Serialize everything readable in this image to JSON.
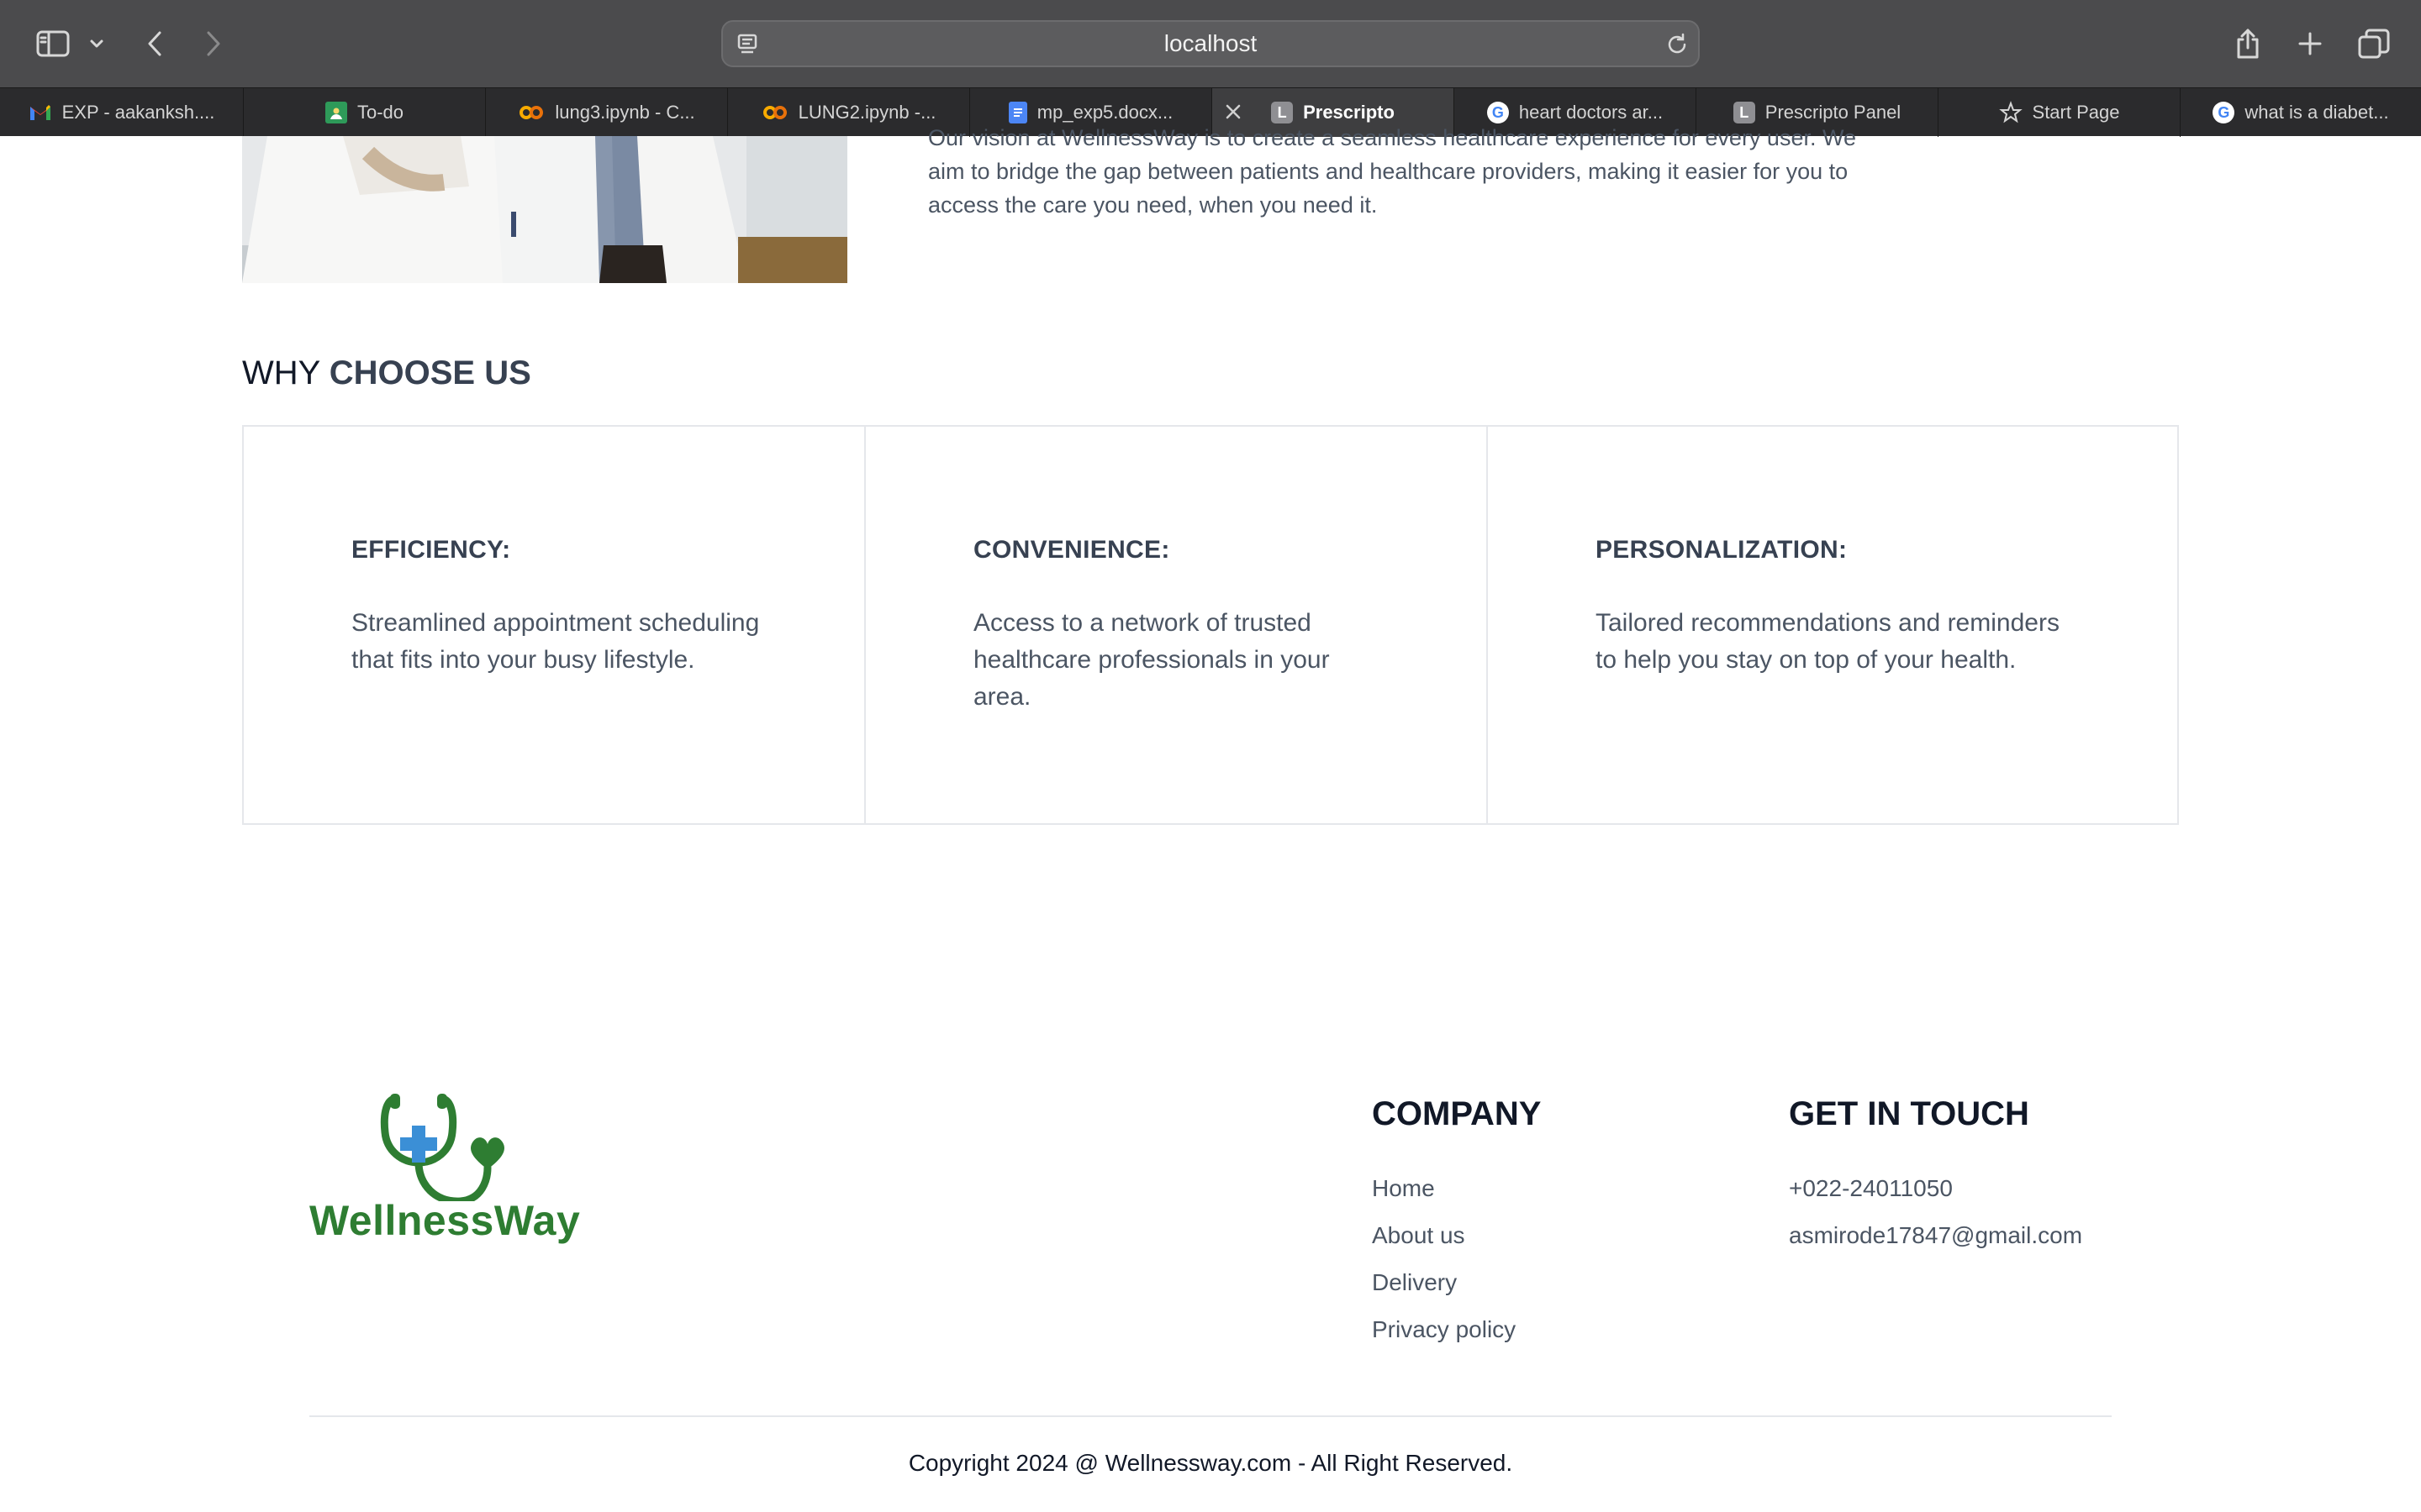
{
  "browser": {
    "url": "localhost",
    "tabs": [
      {
        "label": "EXP - aakanksh....",
        "icon": "gmail-icon"
      },
      {
        "label": "To-do",
        "icon": "todo-icon"
      },
      {
        "label": "lung3.ipynb - C...",
        "icon": "colab-icon"
      },
      {
        "label": "LUNG2.ipynb -...",
        "icon": "colab-icon"
      },
      {
        "label": "mp_exp5.docx...",
        "icon": "docs-icon"
      },
      {
        "label": "Prescripto",
        "icon": "letter-l-icon",
        "favicon_letter": "L",
        "active": true
      },
      {
        "label": "heart doctors ar...",
        "icon": "google-icon",
        "favicon_letter": "G"
      },
      {
        "label": "Prescripto Panel",
        "icon": "letter-l-icon",
        "favicon_letter": "L"
      },
      {
        "label": "Start Page",
        "icon": "star-icon"
      },
      {
        "label": "what is a diabet...",
        "icon": "google-icon",
        "favicon_letter": "G"
      }
    ]
  },
  "about": {
    "vision_text": "Our vision at WellnessWay is to create a seamless healthcare experience for every user. We aim to bridge the gap between patients and healthcare providers, making it easier for you to access the care you need, when you need it."
  },
  "why": {
    "title_prefix": "WHY",
    "title_bold": "CHOOSE US",
    "cards": [
      {
        "title": "EFFICIENCY:",
        "text": "Streamlined appointment scheduling that fits into your busy lifestyle."
      },
      {
        "title": "CONVENIENCE:",
        "text": "Access to a network of trusted healthcare professionals in your area."
      },
      {
        "title": "PERSONALIZATION:",
        "text": "Tailored recommendations and reminders to help you stay on top of your health."
      }
    ]
  },
  "footer": {
    "logo_text": "WellnessWay",
    "company": {
      "title": "COMPANY",
      "links": [
        "Home",
        "About us",
        "Delivery",
        "Privacy policy"
      ]
    },
    "contact": {
      "title": "GET IN TOUCH",
      "phone": "+022-24011050",
      "email": "asmirode17847@gmail.com"
    },
    "copyright": "Copyright 2024 @ Wellnessway.com - All Right Reserved."
  },
  "colors": {
    "brand_green": "#2e7d32",
    "brand_blue": "#3b8fd6",
    "toolbar": "#4b4b4d",
    "tabbar": "#2b2b2d"
  }
}
